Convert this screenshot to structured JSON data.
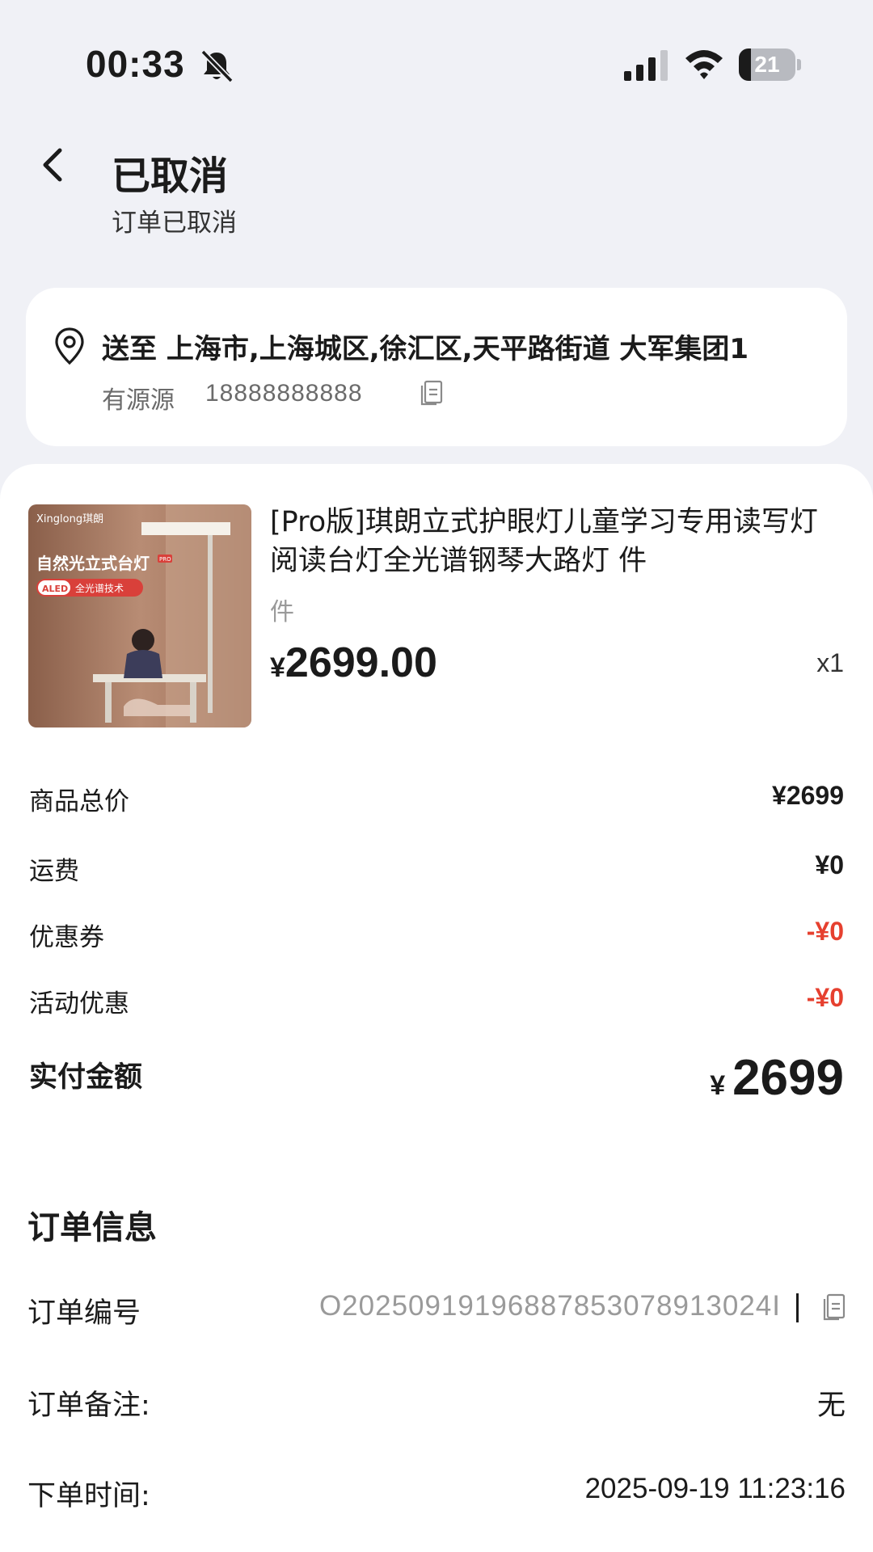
{
  "status_bar": {
    "time": "00:33",
    "battery_level": "21",
    "battery_fraction": 0.21,
    "icons": [
      "bell-muted-icon",
      "signal-icon",
      "wifi-icon",
      "battery-icon"
    ]
  },
  "header": {
    "title": "已取消",
    "subtitle": "订单已取消"
  },
  "address": {
    "text": "送至 上海市,上海城区,徐汇区,天平路街道 大军集团1",
    "name": "有源源",
    "phone": "18888888888"
  },
  "product": {
    "title": "[Pro版]琪朗立式护眼灯儿童学习专用读写灯阅读台灯全光谱钢琴大路灯 件",
    "spec": "件",
    "currency": "¥",
    "price": "2699.00",
    "qty": "x1",
    "image": {
      "brand": "Xinglong琪朗",
      "headline": "自然光立式台灯",
      "pro_tag": "PRO",
      "badge_left": "ALED",
      "badge_right": "全光谱技术"
    }
  },
  "price_summary": {
    "rows": [
      {
        "label": "商品总价",
        "value": "¥2699"
      },
      {
        "label": "运费",
        "value": "¥0"
      },
      {
        "label": "优惠券",
        "value": "-¥0"
      },
      {
        "label": "活动优惠",
        "value": "-¥0"
      }
    ],
    "total_label": "实付金额",
    "total_currency": "¥",
    "total_amount": "2699"
  },
  "order_info": {
    "title": "订单信息",
    "order_no_label": "订单编号",
    "order_no": "O20250919196887853078913024I",
    "note_label": "订单备注:",
    "note_value": "无",
    "time_label": "下单时间:",
    "time_value": "2025-09-19 11:23:16"
  },
  "colors": {
    "background": "#f0f1f6",
    "card": "#ffffff",
    "discount_red": "#e6402f",
    "muted_text": "#9a9a9a"
  }
}
